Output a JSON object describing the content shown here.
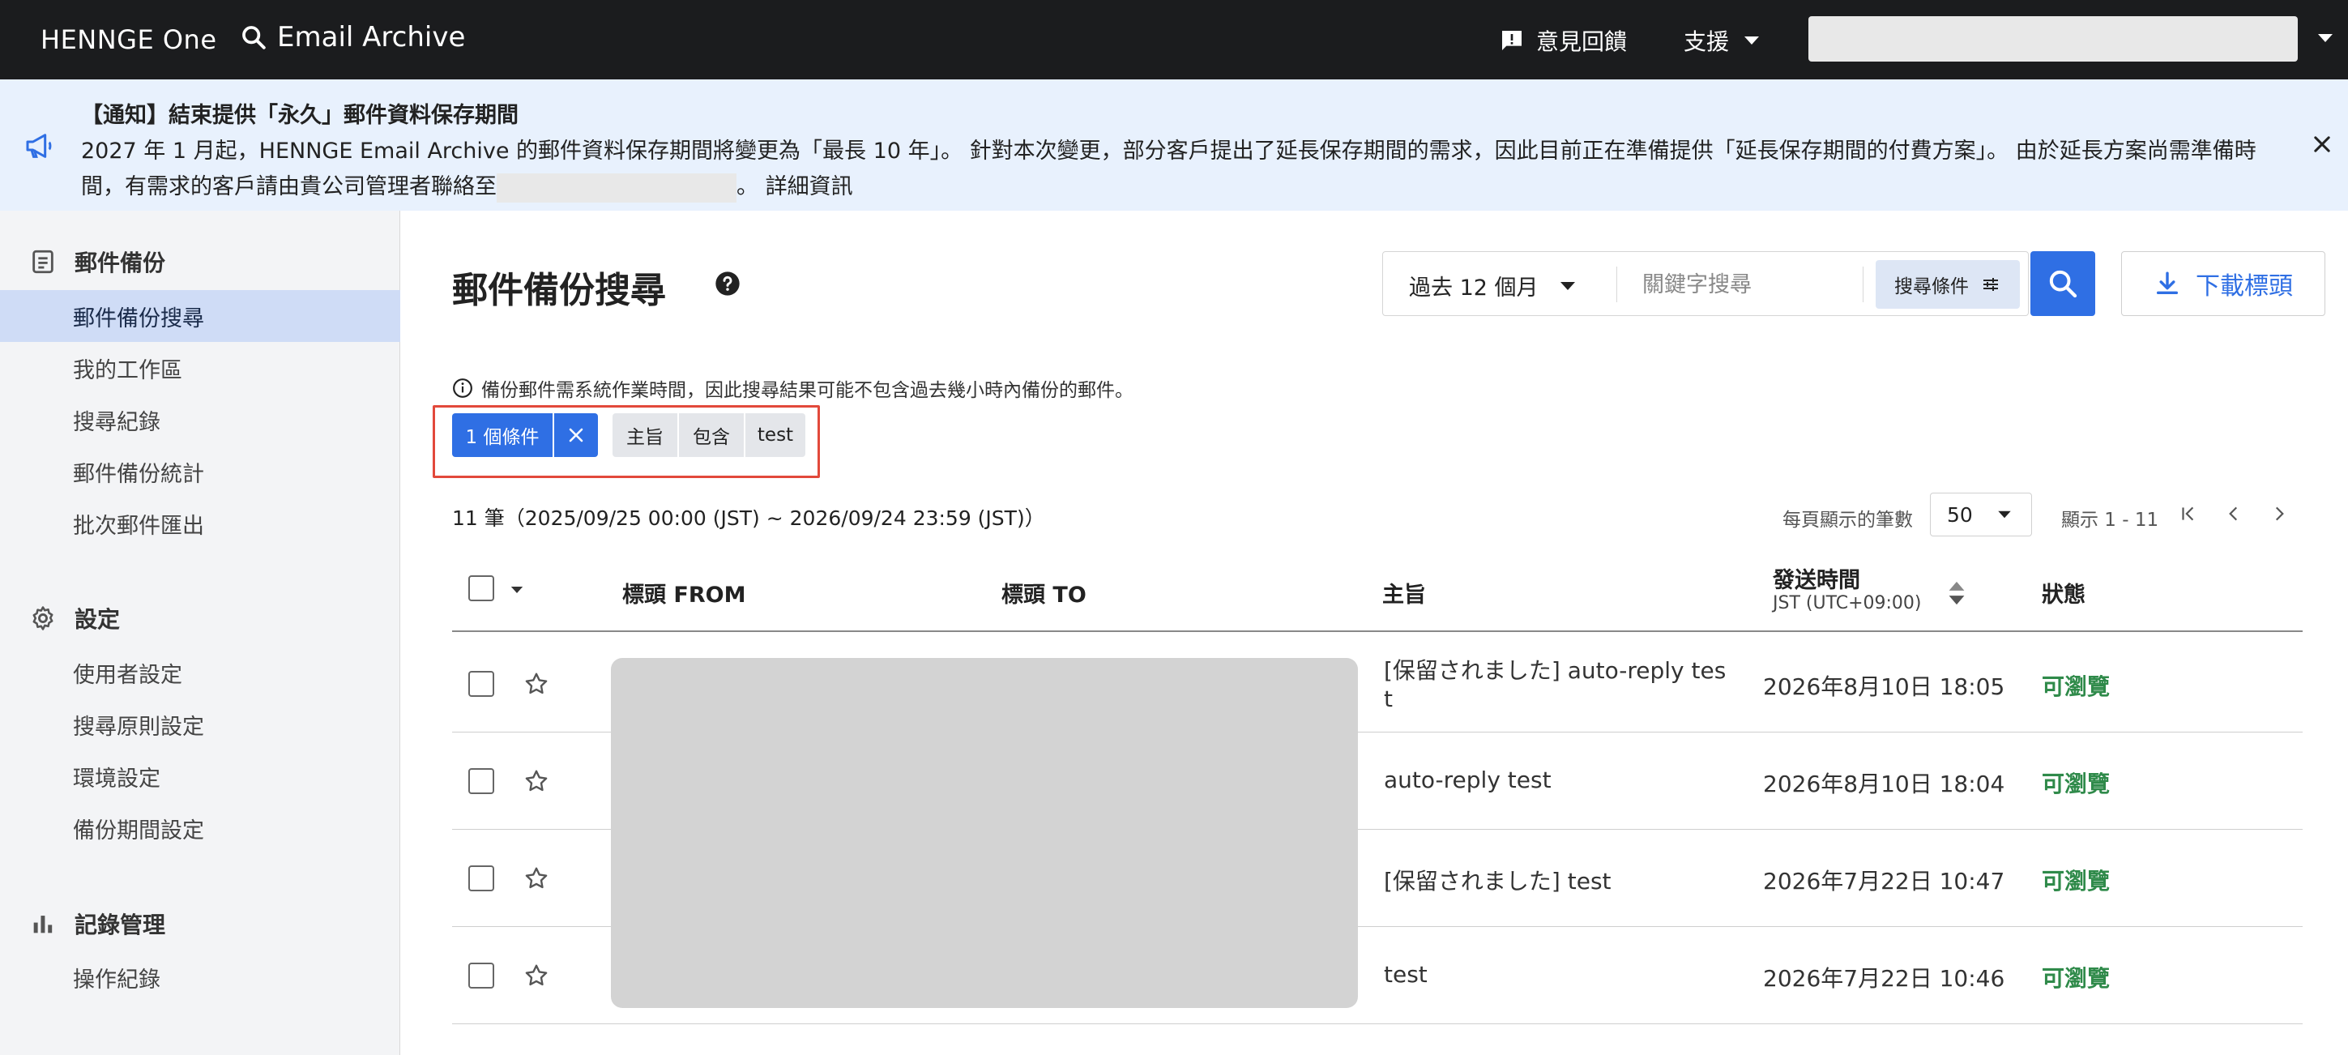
{
  "topbar": {
    "logo": "HENNGE One",
    "app_name": "Email Archive",
    "feedback": "意見回饋",
    "support": "支援"
  },
  "notice": {
    "title": "【通知】結束提供「永久」郵件資料保存期間",
    "body_part1": "2027 年 1 月起，HENNGE Email Archive 的郵件資料保存期間將變更為「最長 10 年」。 針對本次變更，部分客戶提出了延長保存期間的需求，因此目前正在準備提供「延長保存期間的付費方案」。 由於延長方案尚需準備時間，有需求的客戶請由貴公司管理者聯絡至",
    "body_part2": "。",
    "detail_link": "詳細資訊"
  },
  "sidebar": {
    "sections": [
      {
        "title": "郵件備份",
        "icon": "document-list-icon",
        "items": [
          "郵件備份搜尋",
          "我的工作區",
          "搜尋紀錄",
          "郵件備份統計",
          "批次郵件匯出"
        ]
      },
      {
        "title": "設定",
        "icon": "gear-icon",
        "items": [
          "使用者設定",
          "搜尋原則設定",
          "環境設定",
          "備份期間設定"
        ]
      },
      {
        "title": "記錄管理",
        "icon": "bar-chart-icon",
        "items": [
          "操作紀錄"
        ]
      }
    ],
    "active_item": "郵件備份搜尋"
  },
  "main": {
    "title": "郵件備份搜尋",
    "search": {
      "period": "過去 12 個月",
      "keyword_placeholder": "關鍵字搜尋",
      "conditions_label": "搜尋條件"
    },
    "download_label": "下載標頭",
    "info": "備份郵件需系統作業時間，因此搜尋結果可能不包含過去幾小時內備份的郵件。",
    "filter": {
      "count_label": "1 個條件",
      "field": "主旨",
      "operator": "包含",
      "value": "test"
    },
    "range": "11 筆（2025/09/25 00:00 (JST) ~ 2026/09/24 23:59 (JST)）",
    "per_page_label": "每頁顯示的筆數",
    "per_page": "50",
    "showing": "顯示 1 - 11"
  },
  "table": {
    "headers": {
      "from": "標頭 FROM",
      "to": "標頭 TO",
      "subject": "主旨",
      "sent": "發送時間",
      "sent_tz": "JST (UTC+09:00)",
      "status": "狀態"
    },
    "rows": [
      {
        "subject_line1": "[保留されました] auto-reply tes",
        "subject_line2": "t",
        "sent": "2026年8月10日 18:05",
        "status": "可瀏覽"
      },
      {
        "subject_line1": "auto-reply test",
        "subject_line2": "",
        "sent": "2026年8月10日 18:04",
        "status": "可瀏覽"
      },
      {
        "subject_line1": "[保留されました] test",
        "subject_line2": "",
        "sent": "2026年7月22日 10:47",
        "status": "可瀏覽"
      },
      {
        "subject_line1": "test",
        "subject_line2": "",
        "sent": "2026年7月22日 10:46",
        "status": "可瀏覽"
      }
    ]
  },
  "colors": {
    "accent": "#2f6fe4",
    "status_ok": "#2f8a4a",
    "highlight_frame": "#e2493b",
    "topbar": "#1b1c1e",
    "notice_bg": "#e8f1fd"
  }
}
